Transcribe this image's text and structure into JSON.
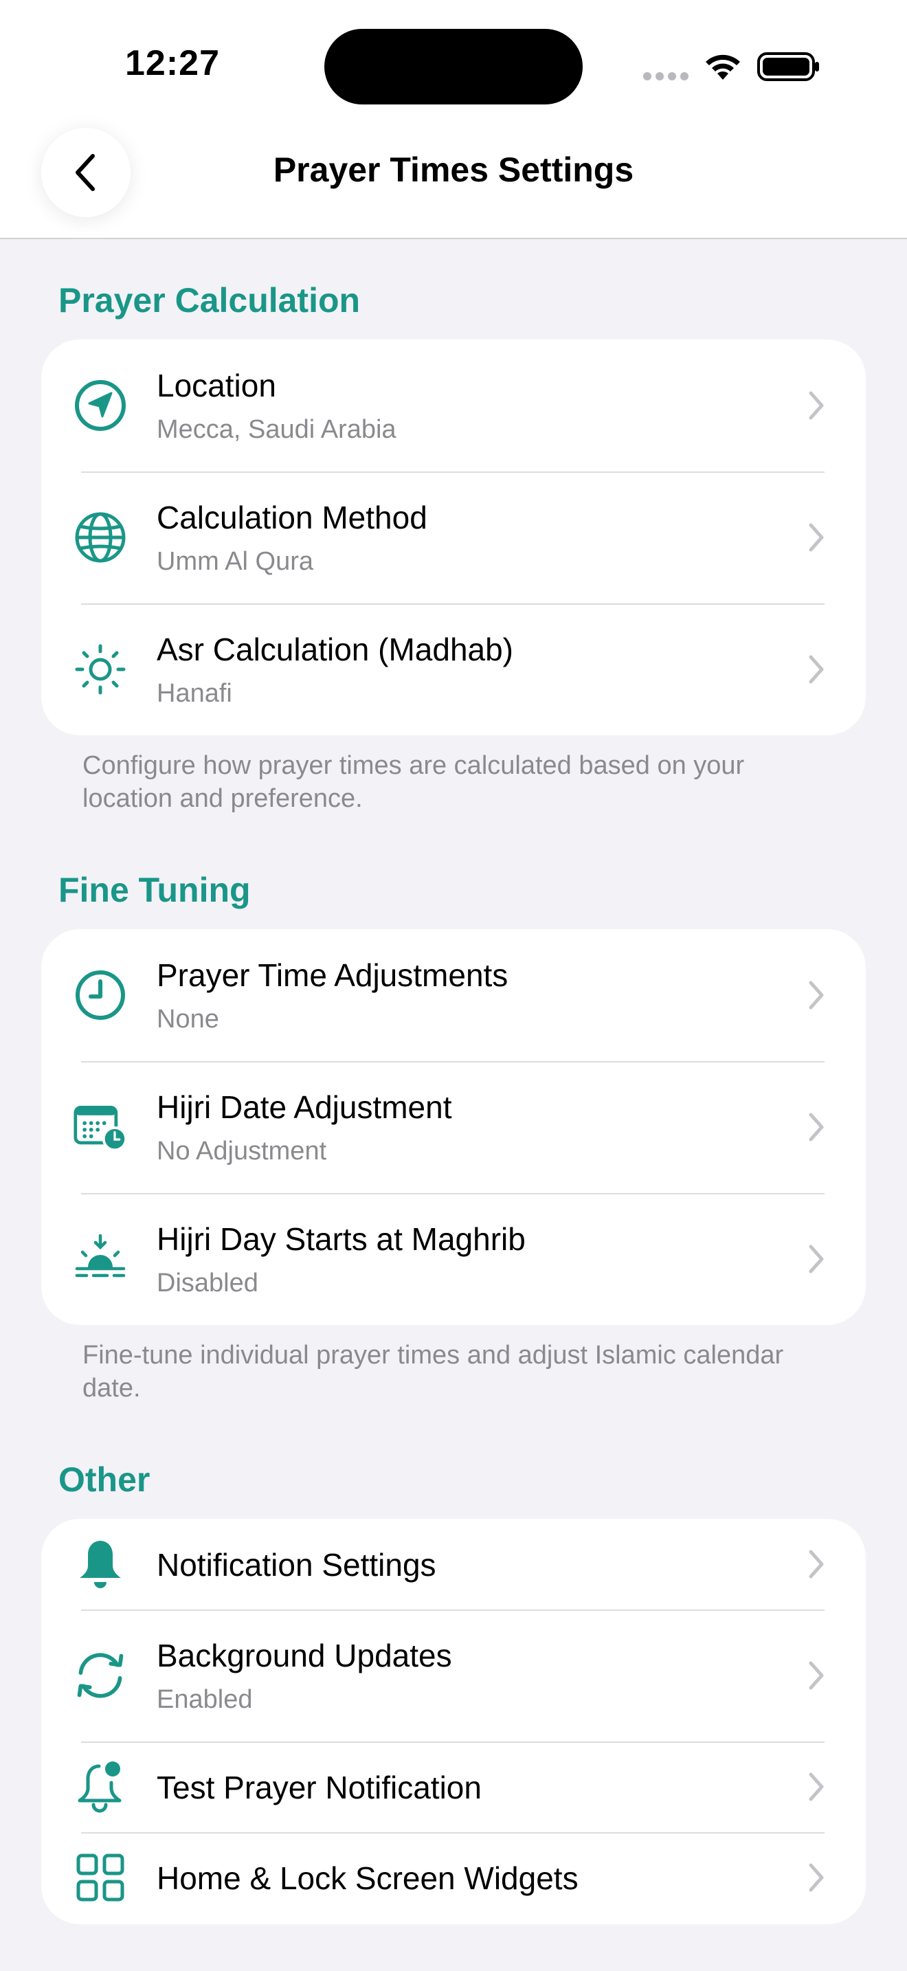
{
  "status_bar": {
    "time": "12:27"
  },
  "nav": {
    "title": "Prayer Times Settings",
    "back_icon": "chevron-left-icon"
  },
  "accent_color": "#1a9688",
  "sections": [
    {
      "header": "Prayer Calculation",
      "footer": "Configure how prayer times are calculated based on your location and preference.",
      "rows": [
        {
          "icon": "location-arrow-icon",
          "title": "Location",
          "subtitle": "Mecca, Saudi Arabia"
        },
        {
          "icon": "globe-icon",
          "title": "Calculation Method",
          "subtitle": "Umm Al Qura"
        },
        {
          "icon": "sun-icon",
          "title": "Asr Calculation (Madhab)",
          "subtitle": "Hanafi"
        }
      ]
    },
    {
      "header": "Fine Tuning",
      "footer": "Fine-tune individual prayer times and adjust Islamic calendar date.",
      "rows": [
        {
          "icon": "clock-icon",
          "title": "Prayer Time Adjustments",
          "subtitle": "None"
        },
        {
          "icon": "calendar-clock-icon",
          "title": "Hijri Date Adjustment",
          "subtitle": "No Adjustment"
        },
        {
          "icon": "sunset-icon",
          "title": "Hijri Day Starts at Maghrib",
          "subtitle": "Disabled"
        }
      ]
    },
    {
      "header": "Other",
      "rows": [
        {
          "icon": "bell-fill-icon",
          "title": "Notification Settings"
        },
        {
          "icon": "refresh-icon",
          "title": "Background Updates",
          "subtitle": "Enabled"
        },
        {
          "icon": "bell-badge-icon",
          "title": "Test Prayer Notification"
        },
        {
          "icon": "widgets-grid-icon",
          "title": "Home & Lock Screen Widgets"
        }
      ]
    }
  ]
}
